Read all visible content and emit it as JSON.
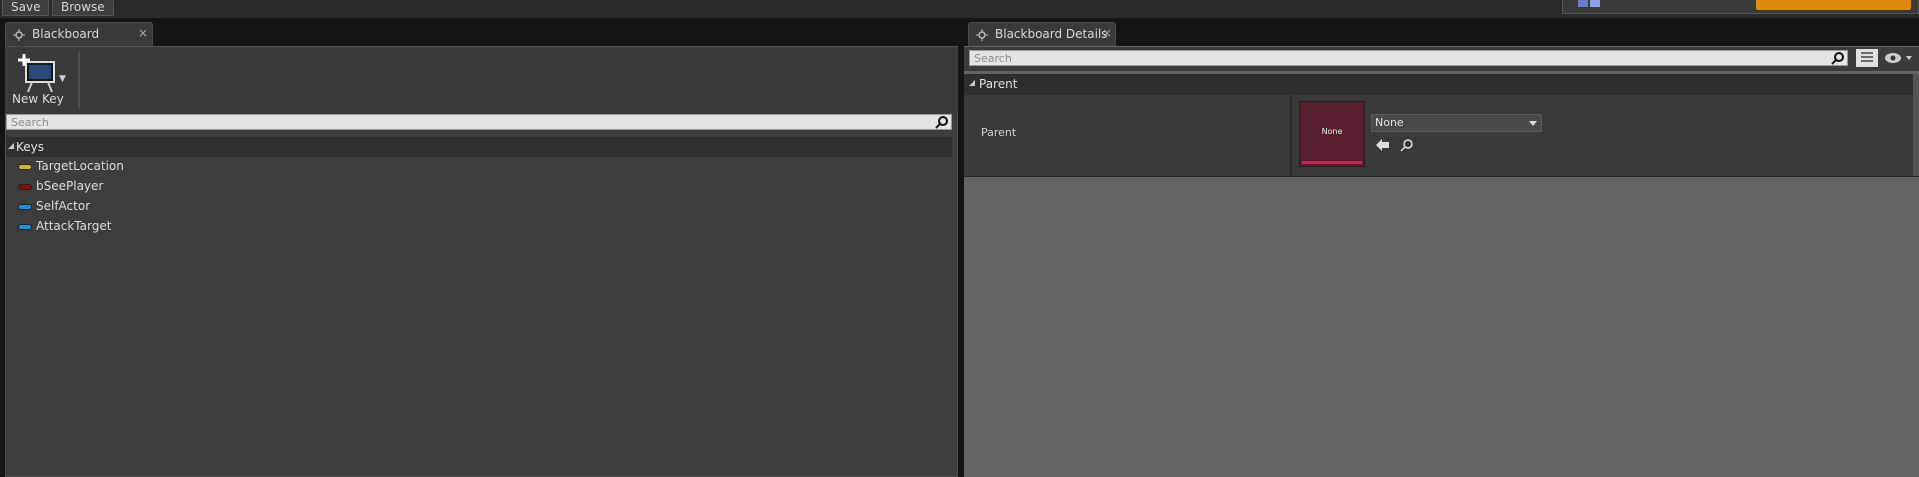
{
  "toolbar": {
    "save_label": "Save",
    "browse_label": "Browse"
  },
  "left_tab": {
    "title": "Blackboard",
    "close": "×"
  },
  "right_tab": {
    "title": "Blackboard Details",
    "close": "×"
  },
  "blackboard": {
    "new_key_label": "New Key",
    "search_placeholder": "Search",
    "section_title": "Keys",
    "keys": [
      {
        "label": "TargetLocation",
        "color": "#d7b51e"
      },
      {
        "label": "bSeePlayer",
        "color": "#8c1010"
      },
      {
        "label": "SelfActor",
        "color": "#1f8fe0"
      },
      {
        "label": "AttackTarget",
        "color": "#1f8fe0"
      }
    ]
  },
  "details": {
    "search_placeholder": "Search",
    "section_title": "Parent",
    "parent_label": "Parent",
    "asset_thumb_text": "None",
    "asset_value": "None"
  },
  "colors": {
    "accent_orange": "#e08a12",
    "asset_bar": "#c02a5a"
  },
  "icons": [
    "tab-blackboard-icon",
    "tab-details-icon",
    "new-key-icon",
    "search-icon",
    "list-view-icon",
    "eye-icon",
    "use-selected-arrow-icon",
    "browse-magnifier-icon"
  ]
}
